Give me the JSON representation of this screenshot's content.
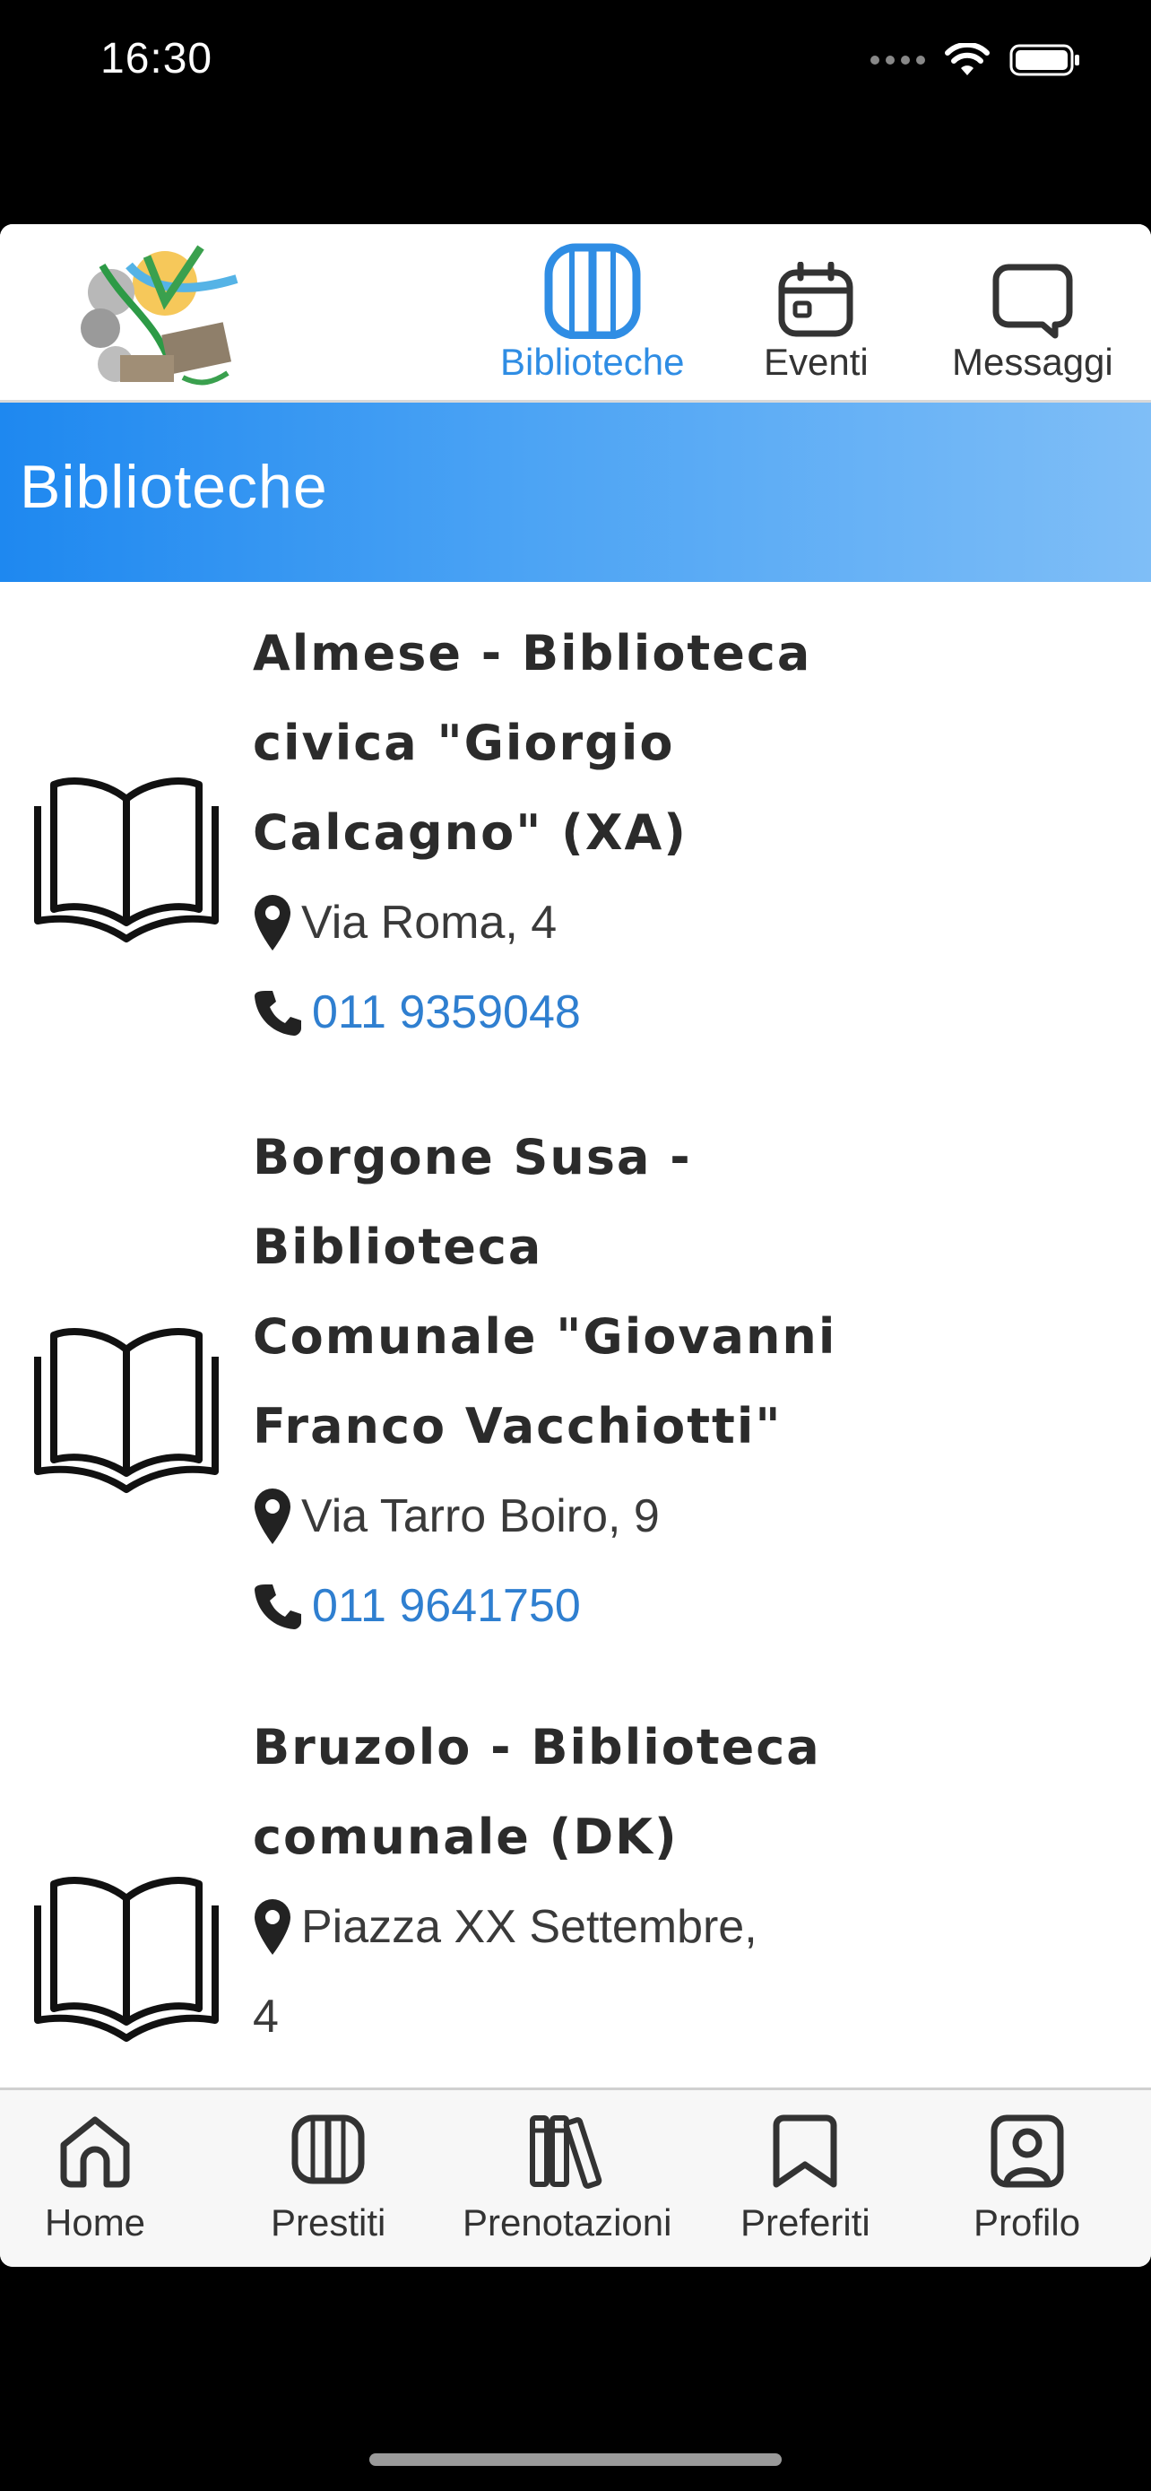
{
  "status_bar": {
    "time": "16:30",
    "icons": [
      "cellular-signal-icon",
      "wifi-icon",
      "battery-icon"
    ]
  },
  "top_nav": {
    "logo": "app-logo",
    "tabs": [
      {
        "label": "Biblioteche",
        "icon": "open-book-icon",
        "active": true
      },
      {
        "label": "Eventi",
        "icon": "calendar-icon",
        "active": false
      },
      {
        "label": "Messaggi",
        "icon": "chat-bubbles-icon",
        "active": false
      }
    ]
  },
  "header": {
    "title": "Biblioteche"
  },
  "libraries": [
    {
      "name_lines": [
        "Almese - Biblioteca",
        "civica \"Giorgio",
        "Calcagno\" (XA)"
      ],
      "address": "Via Roma, 4",
      "phone": "011 9359048",
      "icon": "open-book-icon"
    },
    {
      "name_lines": [
        "Borgone Susa -",
        "Biblioteca",
        "Comunale \"Giovanni",
        "Franco Vacchiotti\""
      ],
      "address": "Via Tarro Boiro, 9",
      "phone": "011 9641750",
      "icon": "open-book-icon"
    },
    {
      "name_lines": [
        "Bruzolo - Biblioteca",
        "comunale (DK)"
      ],
      "address_lines": [
        "Piazza XX Settembre,",
        "4"
      ],
      "icon": "open-book-icon"
    }
  ],
  "bottom_nav": {
    "tabs": [
      {
        "label": "Home",
        "icon": "home-icon"
      },
      {
        "label": "Prestiti",
        "icon": "book-loans-icon"
      },
      {
        "label": "Prenotazioni",
        "icon": "books-shelf-icon"
      },
      {
        "label": "Preferiti",
        "icon": "bookmark-icon"
      },
      {
        "label": "Profilo",
        "icon": "profile-icon"
      }
    ]
  },
  "colors": {
    "accent": "#2f8de4",
    "header_gradient_start": "#1e88f0",
    "header_gradient_end": "#7fbef7",
    "phone_link": "#2f7fd0"
  }
}
